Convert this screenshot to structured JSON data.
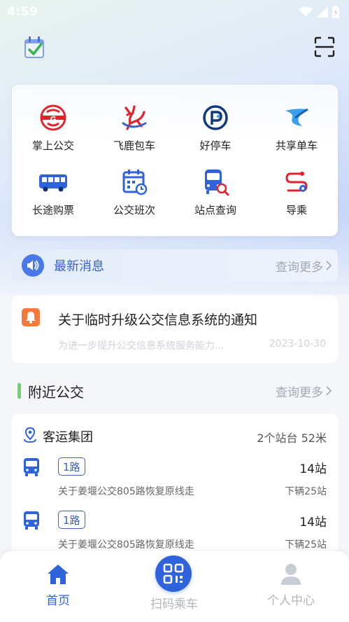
{
  "status_bar": {
    "time": "4:59"
  },
  "services": [
    {
      "label": "掌上公交",
      "icon": "bus-logo-icon"
    },
    {
      "label": "飞鹿包车",
      "icon": "deer-icon"
    },
    {
      "label": "好停车",
      "icon": "parking-icon"
    },
    {
      "label": "共享单车",
      "icon": "bike-icon"
    },
    {
      "label": "长途购票",
      "icon": "coach-bus-icon"
    },
    {
      "label": "公交班次",
      "icon": "schedule-icon"
    },
    {
      "label": "站点查询",
      "icon": "stop-search-icon"
    },
    {
      "label": "导乘",
      "icon": "route-guide-icon"
    }
  ],
  "notice": {
    "title": "最新消息",
    "more": "查询更多"
  },
  "news": {
    "title": "关于临时升级公交信息系统的通知",
    "summary": "为进一步提升公交信息系统服务能力...",
    "date": "2023-10-30"
  },
  "nearby": {
    "title": "附近公交",
    "more": "查询更多",
    "stop": {
      "name": "客运集团",
      "info": "2个站台 52米"
    },
    "routes": [
      {
        "badge": "1路",
        "stations": "14站",
        "desc": "关于姜堰公交805路恢复原线走",
        "next": "下辆25站"
      },
      {
        "badge": "1路",
        "stations": "14站",
        "desc": "关于姜堰公交805路恢复原线走",
        "next": "下辆25站"
      }
    ]
  },
  "tabs": [
    {
      "label": "首页",
      "active": true
    },
    {
      "label": "扫码乘车",
      "active": false
    },
    {
      "label": "个人中心",
      "active": false
    }
  ],
  "colors": {
    "accent": "#2f63dc",
    "primary_text": "#3a62c4",
    "inactive_tab": "#b0b4bc",
    "section_bar": "#6fd46b",
    "news_icon": "#f5793a"
  }
}
